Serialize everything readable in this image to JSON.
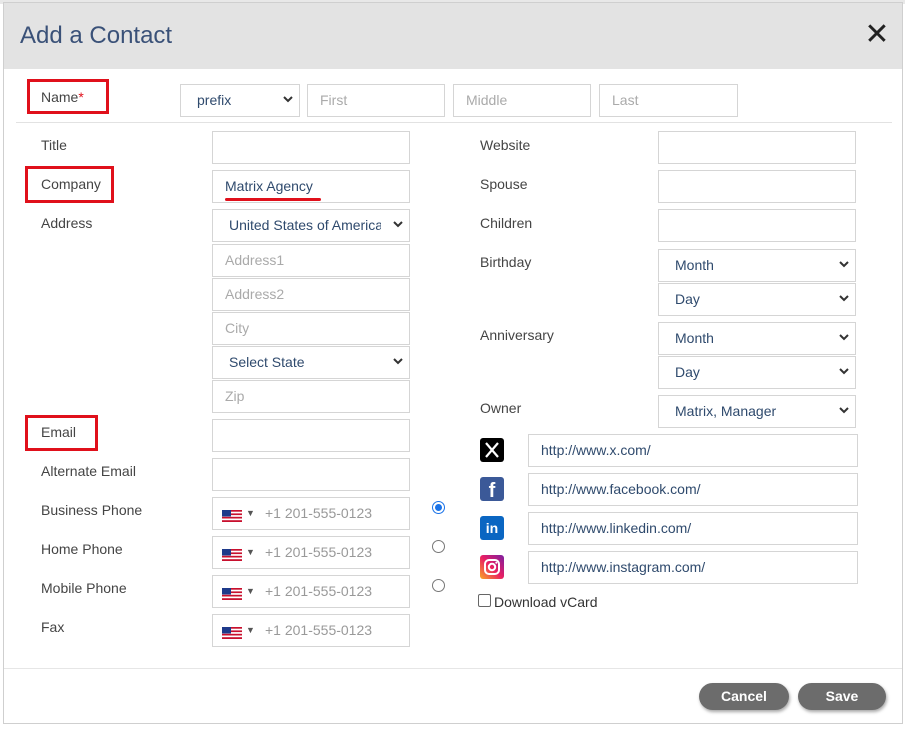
{
  "dialog": {
    "title": "Add a Contact",
    "close_label": "✕"
  },
  "name": {
    "label": "Name",
    "required_mark": "*",
    "prefix_value": "prefix",
    "first_placeholder": "First",
    "middle_placeholder": "Middle",
    "last_placeholder": "Last"
  },
  "left": {
    "title_label": "Title",
    "company_label": "Company",
    "company_value": "Matrix Agency",
    "address_label": "Address",
    "country_value": "United States of America",
    "address1_placeholder": "Address1",
    "address2_placeholder": "Address2",
    "city_placeholder": "City",
    "state_value": "Select State",
    "zip_placeholder": "Zip",
    "email_label": "Email",
    "alt_email_label": "Alternate Email",
    "business_phone_label": "Business Phone",
    "home_phone_label": "Home Phone",
    "mobile_phone_label": "Mobile Phone",
    "fax_label": "Fax",
    "phone_placeholder": "+1 201-555-0123",
    "primary_phone_selected": "business"
  },
  "right": {
    "website_label": "Website",
    "spouse_label": "Spouse",
    "children_label": "Children",
    "birthday_label": "Birthday",
    "birthday_month": "Month",
    "birthday_day": "Day",
    "anniversary_label": "Anniversary",
    "anniversary_month": "Month",
    "anniversary_day": "Day",
    "owner_label": "Owner",
    "owner_value": "Matrix, Manager",
    "social": {
      "x": "http://www.x.com/",
      "facebook": "http://www.facebook.com/",
      "linkedin": "http://www.linkedin.com/",
      "instagram": "http://www.instagram.com/"
    },
    "download_vcard_label": "Download vCard"
  },
  "footer": {
    "cancel_label": "Cancel",
    "save_label": "Save"
  },
  "colors": {
    "highlight": "#e0101b",
    "title": "#3a5178",
    "button": "#6c6c6c",
    "radio": "#1a73e8"
  },
  "icons": [
    "close-icon",
    "chevron-down-icon",
    "us-flag-icon",
    "x-icon",
    "facebook-icon",
    "linkedin-icon",
    "instagram-icon"
  ]
}
